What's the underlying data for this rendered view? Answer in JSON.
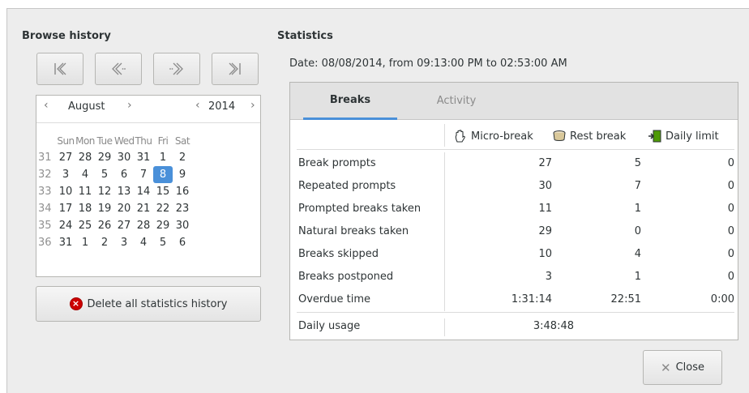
{
  "browse": {
    "title": "Browse history",
    "nav": [
      "first",
      "previous",
      "next",
      "last"
    ]
  },
  "calendar": {
    "month": "August",
    "year": "2014",
    "weekday_headers": [
      "Sun",
      "Mon",
      "Tue",
      "Wed",
      "Thu",
      "Fri",
      "Sat"
    ],
    "weeks": [
      {
        "wk": "31",
        "days": [
          "27",
          "28",
          "29",
          "30",
          "31",
          "1",
          "2"
        ]
      },
      {
        "wk": "32",
        "days": [
          "3",
          "4",
          "5",
          "6",
          "7",
          "8",
          "9"
        ]
      },
      {
        "wk": "33",
        "days": [
          "10",
          "11",
          "12",
          "13",
          "14",
          "15",
          "16"
        ]
      },
      {
        "wk": "34",
        "days": [
          "17",
          "18",
          "19",
          "20",
          "21",
          "22",
          "23"
        ]
      },
      {
        "wk": "35",
        "days": [
          "24",
          "25",
          "26",
          "27",
          "28",
          "29",
          "30"
        ]
      },
      {
        "wk": "36",
        "days": [
          "31",
          "1",
          "2",
          "3",
          "4",
          "5",
          "6"
        ]
      }
    ],
    "selected_day": "8"
  },
  "delete_button": {
    "label": "Delete all statistics history"
  },
  "statistics": {
    "title": "Statistics",
    "date_line": "Date:  08/08/2014, from 09:13:00 PM to 02:53:00 AM",
    "tabs": [
      {
        "label": "Breaks",
        "active": true
      },
      {
        "label": "Activity",
        "active": false
      }
    ],
    "columns": [
      {
        "label": "Micro-break",
        "icon": "hand-icon"
      },
      {
        "label": "Rest break",
        "icon": "coffee-cup-icon"
      },
      {
        "label": "Daily limit",
        "icon": "exit-icon"
      }
    ],
    "rows": [
      {
        "label": "Break prompts",
        "values": [
          "27",
          "5",
          "0"
        ]
      },
      {
        "label": "Repeated prompts",
        "values": [
          "30",
          "7",
          "0"
        ]
      },
      {
        "label": "Prompted breaks taken",
        "values": [
          "11",
          "1",
          "0"
        ]
      },
      {
        "label": "Natural breaks taken",
        "values": [
          "29",
          "0",
          "0"
        ]
      },
      {
        "label": "Breaks skipped",
        "values": [
          "10",
          "4",
          "0"
        ]
      },
      {
        "label": "Breaks postponed",
        "values": [
          "3",
          "1",
          "0"
        ]
      },
      {
        "label": "Overdue time",
        "values": [
          "1:31:14",
          "22:51",
          "0:00"
        ]
      }
    ],
    "daily_usage": {
      "label": "Daily usage",
      "value": "3:48:48"
    }
  },
  "close_button": {
    "label": "Close"
  },
  "colors": {
    "accent": "#4a90d9",
    "delete_icon": "#cc0000"
  }
}
